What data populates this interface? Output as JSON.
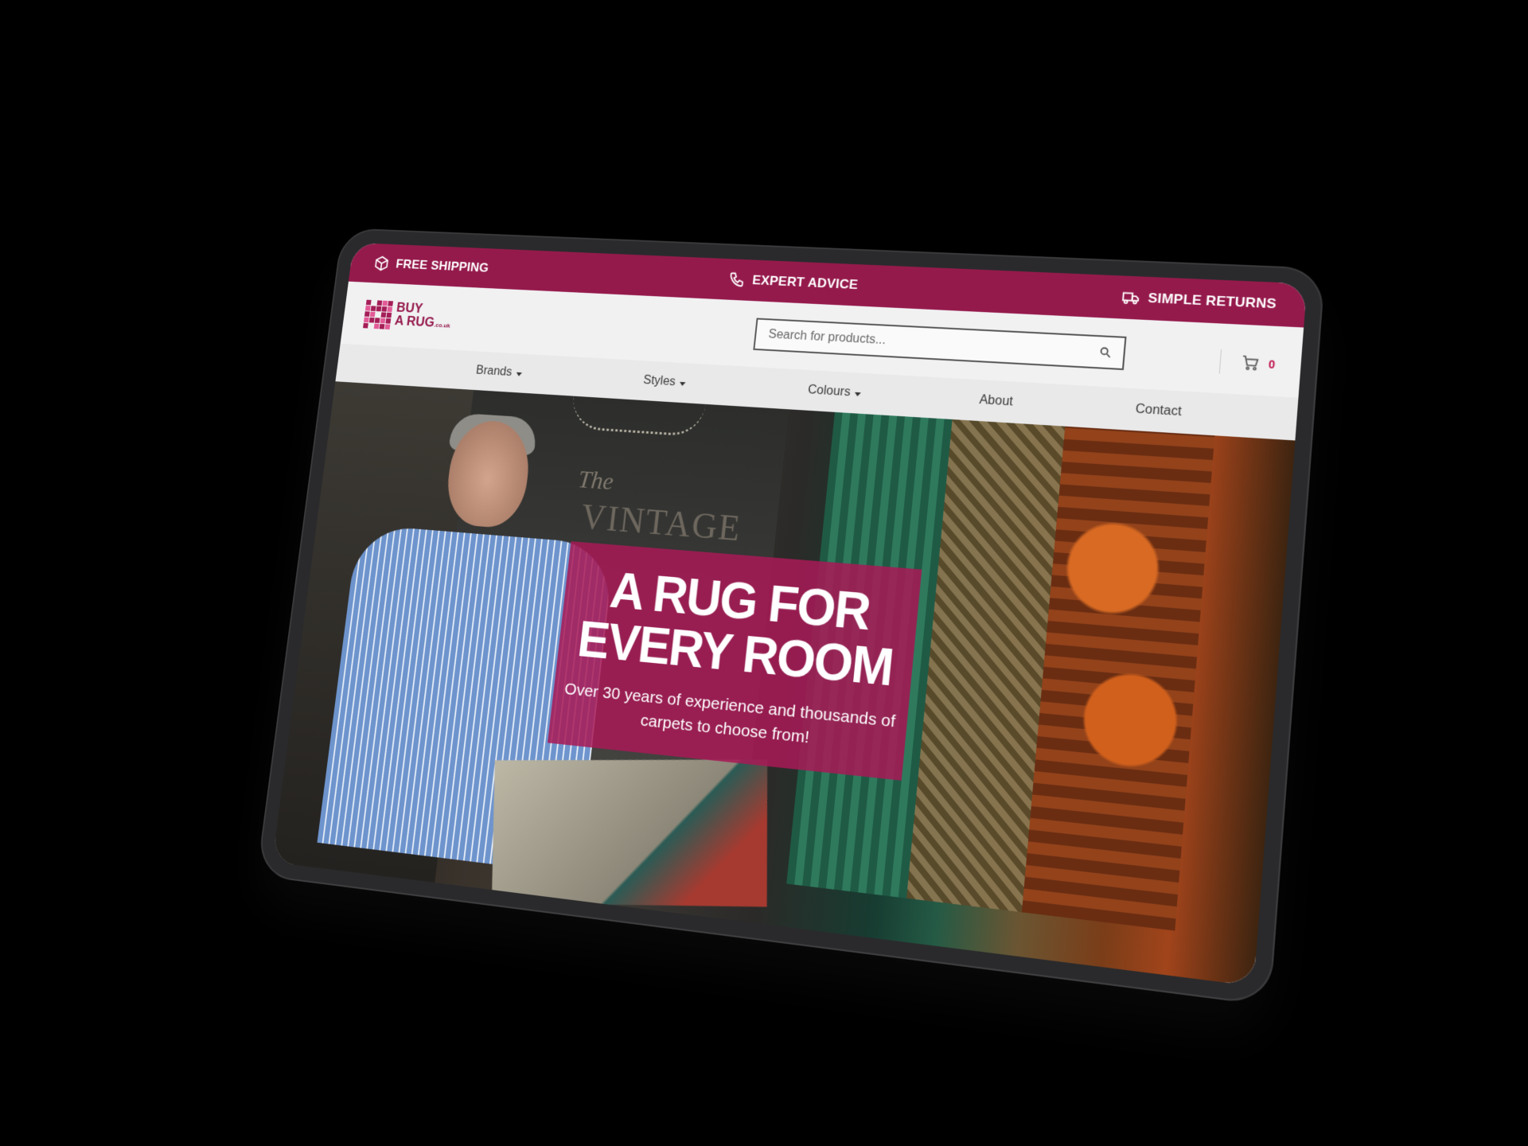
{
  "promo": {
    "shipping": "FREE SHIPPING",
    "advice": "EXPERT ADVICE",
    "returns": "SIMPLE RETURNS"
  },
  "logo": {
    "line1": "BUY",
    "line2": "A RUG",
    "suffix": ".co.uk"
  },
  "search": {
    "placeholder": "Search for products..."
  },
  "cart": {
    "count": "0"
  },
  "nav": {
    "items": [
      {
        "label": "Brands"
      },
      {
        "label": "Styles"
      },
      {
        "label": "Colours"
      },
      {
        "label": "About"
      },
      {
        "label": "Contact"
      }
    ]
  },
  "hero": {
    "background_text_the": "The",
    "background_text_vintage": "VINTAGE",
    "headline_line1": "A RUG FOR",
    "headline_line2": "EVERY ROOM",
    "subtitle": "Over 30 years of experience and thousands of carpets to choose from!"
  },
  "colors": {
    "brand": "#951a4c",
    "overlay": "#a81a56",
    "cart_count": "#c0174f"
  },
  "icons": {
    "shipping": "box-icon",
    "advice": "phone-icon",
    "returns": "truck-icon",
    "search": "search-icon",
    "cart": "cart-icon"
  }
}
